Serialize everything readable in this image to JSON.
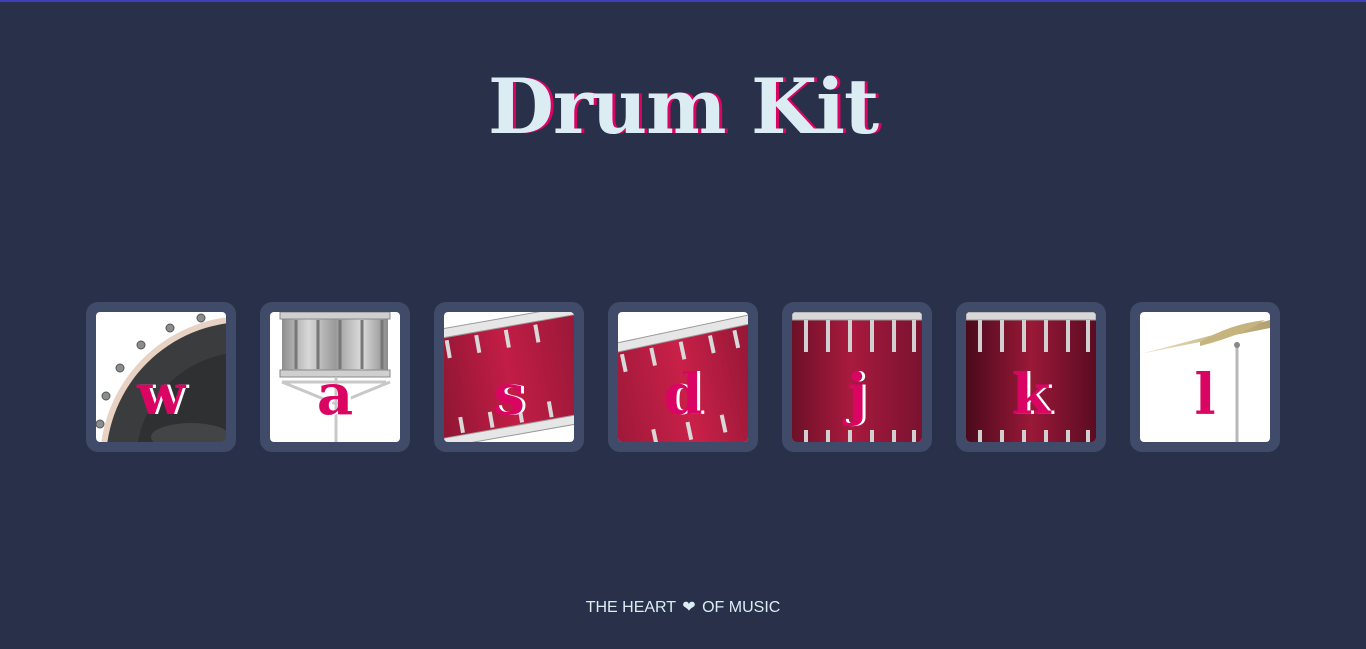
{
  "page": {
    "title": "Drum Kit",
    "footer": {
      "before": "THE HEART",
      "icon": "heart-icon",
      "after": "OF MUSIC"
    }
  },
  "colors": {
    "background": "#283149",
    "button_frame": "#404b69",
    "accent": "#da0463",
    "text": "#dbedf3"
  },
  "drums": [
    {
      "key": "w",
      "instrument": "crash-drum",
      "image": "bass-drum-head"
    },
    {
      "key": "a",
      "instrument": "kick-bass",
      "image": "snare-drum-on-stand"
    },
    {
      "key": "s",
      "instrument": "snare",
      "image": "red-tom-tilted-left"
    },
    {
      "key": "d",
      "instrument": "tom-1",
      "image": "red-tom-tilted-right"
    },
    {
      "key": "j",
      "instrument": "tom-2",
      "image": "red-floor-tom"
    },
    {
      "key": "k",
      "instrument": "tom-3",
      "image": "dark-red-floor-tom"
    },
    {
      "key": "l",
      "instrument": "tom-4",
      "image": "cymbal-on-stand"
    }
  ]
}
